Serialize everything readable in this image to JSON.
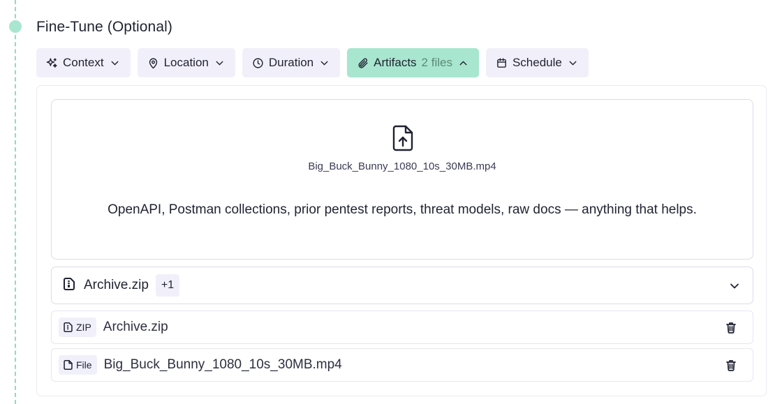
{
  "section": {
    "title": "Fine-Tune (Optional)"
  },
  "chips": [
    {
      "label": "Context",
      "icon": "sparkles-icon",
      "state": "collapsed"
    },
    {
      "label": "Location",
      "icon": "map-pin-icon",
      "state": "collapsed"
    },
    {
      "label": "Duration",
      "icon": "clock-icon",
      "state": "collapsed"
    },
    {
      "label": "Artifacts",
      "count": "2 files",
      "icon": "paperclip-icon",
      "state": "expanded"
    },
    {
      "label": "Schedule",
      "icon": "calendar-icon",
      "state": "collapsed"
    }
  ],
  "dropzone": {
    "icon": "file-upload-icon",
    "uploaded_name": "Big_Buck_Bunny_1080_10s_30MB.mp4",
    "hint": "OpenAPI, Postman collections, prior pentest reports, threat models, raw docs — anything that helps."
  },
  "summary_row": {
    "name": "Archive.zip",
    "extra_count": "+1"
  },
  "files": [
    {
      "type": "ZIP",
      "name": "Archive.zip"
    },
    {
      "type": "File",
      "name": "Big_Buck_Bunny_1080_10s_30MB.mp4"
    }
  ],
  "colors": {
    "accent": "#a8e6cf",
    "chip_bg": "#f1f0fa",
    "timeline": "#8fdcc0"
  }
}
